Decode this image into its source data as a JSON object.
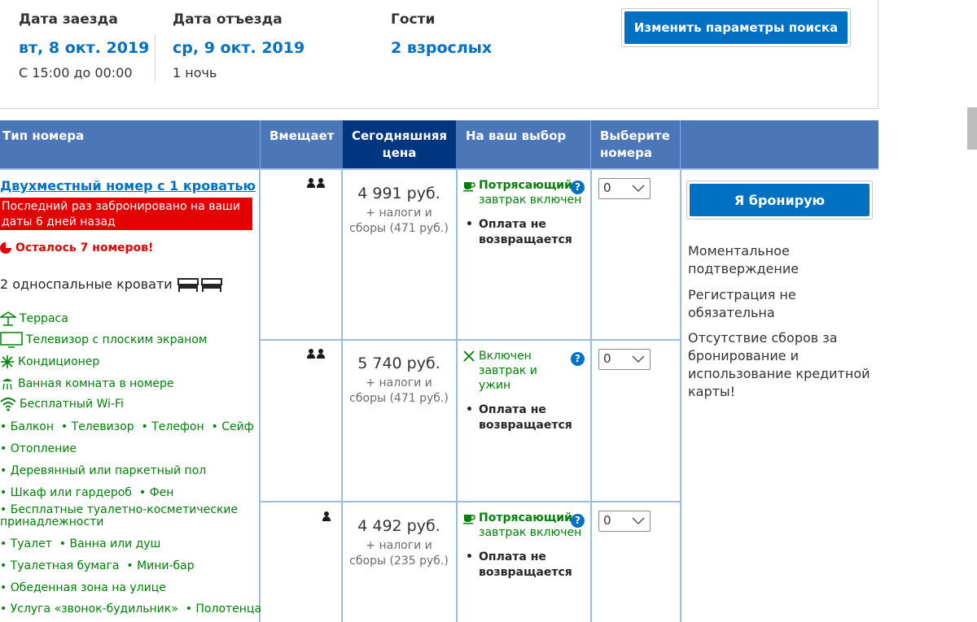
{
  "summary": {
    "checkin_label": "Дата заезда",
    "checkin_date": "вт, 8 окт. 2019",
    "checkin_time": "С 15:00 до 00:00",
    "checkout_label": "Дата отъезда",
    "checkout_date": "ср, 9 окт. 2019",
    "nights": "1 ночь",
    "guests_label": "Гости",
    "guests_value": "2 взрослых",
    "change_button": "Изменить параметры поиска"
  },
  "table_headers": {
    "room_type": "Тип номера",
    "capacity": "Вмещает",
    "today_price_line1": "Сегодняшняя",
    "today_price_line2": "цена",
    "your_choice": "На ваш выбор",
    "select_line1": "Выберите",
    "select_line2": "номера"
  },
  "room": {
    "title": "Двухместный номер с 1 кроватью",
    "last_booked": "Последний раз забронировано на ваши даты 6 дней назад",
    "remaining": "Осталось 7 номеров!",
    "beds": "2 односпальные кровати",
    "facilities_icons": [
      {
        "label": "Терраса",
        "icon": "terrace-icon"
      },
      {
        "label": "Телевизор с плоским экраном",
        "icon": "tv-icon"
      },
      {
        "label": "Кондиционер",
        "icon": "snowflake-icon"
      },
      {
        "label": "Ванная комната в номере",
        "icon": "shower-icon"
      },
      {
        "label": "Бесплатный Wi-Fi",
        "icon": "wifi-icon"
      }
    ],
    "facilities_list": [
      "Балкон",
      "Телевизор",
      "Телефон",
      "Сейф",
      "Отопление",
      "Деревянный или паркетный пол",
      "Шкаф или гардероб",
      "Фен",
      "Бесплатные туалетно-косметические принадлежности",
      "Туалет",
      "Ванна или душ",
      "Туалетная бумага",
      "Мини-бар",
      "Обеденная зона на улице",
      "Услуга «звонок-будильник»",
      "Полотенца"
    ]
  },
  "options": [
    {
      "capacity": 2,
      "price": "4 991 руб.",
      "tax_line1": "+ налоги и",
      "tax_line2": "сборы (471 руб.)",
      "meal_bold": "Потрясающий",
      "meal_rest": "завтрак включен",
      "meal_icon": "coffee-cup-icon",
      "policy": "Оплата не возвращается",
      "selected": "0"
    },
    {
      "capacity": 2,
      "price": "5 740 руб.",
      "tax_line1": "+ налоги и",
      "tax_line2": "сборы (471 руб.)",
      "meal_bold": "",
      "meal_rest": "Включен завтрак и ужин",
      "meal_icon": "cutlery-icon",
      "policy": "Оплата не возвращается",
      "selected": "0"
    },
    {
      "capacity": 1,
      "price": "4 492 руб.",
      "tax_line1": "+ налоги и",
      "tax_line2": "сборы (235 руб.)",
      "meal_bold": "Потрясающий",
      "meal_rest": "завтрак включен",
      "meal_icon": "coffee-cup-icon",
      "policy": "Оплата не возвращается",
      "selected": "0"
    }
  ],
  "booking": {
    "button": "Я бронирую",
    "perks": [
      "Моментальное подтверждение",
      "Регистрация не обязательна",
      "Отсутствие сборов за бронирование и использование кредитной карты!"
    ]
  },
  "colors": {
    "accent": "#0071c2",
    "header": "#4b76b7",
    "header_dark": "#003580",
    "green": "#008009",
    "alert": "#e30000"
  }
}
